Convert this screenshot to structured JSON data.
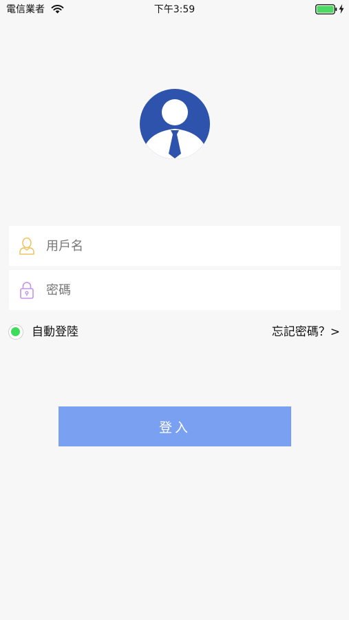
{
  "status_bar": {
    "carrier": "電信業者",
    "time": "下午3:59",
    "wifi_icon": "wifi-icon",
    "battery_icon": "battery-charging-icon",
    "battery_color": "#4cd964"
  },
  "avatar": {
    "icon": "user-avatar-icon",
    "color": "#2d53ad"
  },
  "form": {
    "username": {
      "placeholder": "用戶名",
      "value": "",
      "icon": "user-icon",
      "icon_color": "#f0c466"
    },
    "password": {
      "placeholder": "密碼",
      "value": "",
      "icon": "lock-icon",
      "icon_color": "#c592e8"
    }
  },
  "options": {
    "auto_login_label": "自動登陸",
    "auto_login_checked": true,
    "forgot_label": "忘記密碼？>"
  },
  "login_button": {
    "label": "登入",
    "color": "#7aa0f2"
  }
}
